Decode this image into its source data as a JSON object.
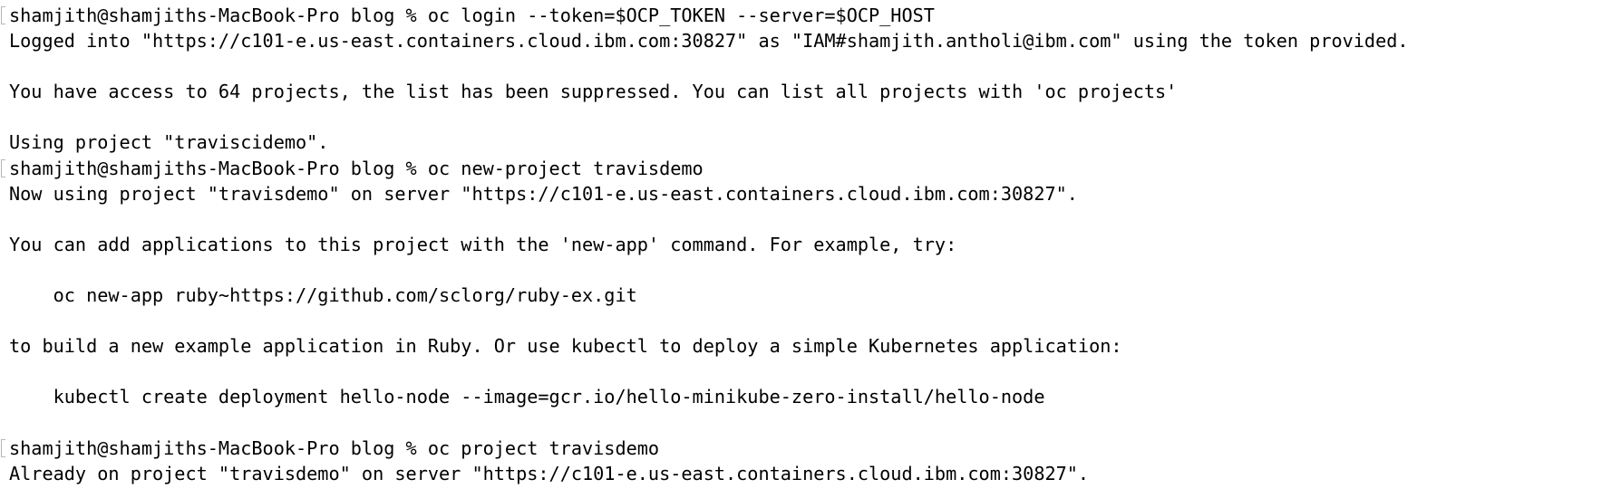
{
  "terminal": {
    "lines": [
      {
        "text": "shamjith@shamjiths-MacBook-Pro blog % oc login --token=$OCP_TOKEN --server=$OCP_HOST",
        "prompt": true
      },
      {
        "text": "Logged into \"https://c101-e.us-east.containers.cloud.ibm.com:30827\" as \"IAM#shamjith.antholi@ibm.com\" using the token provided.",
        "prompt": false
      },
      {
        "text": "",
        "prompt": false
      },
      {
        "text": "You have access to 64 projects, the list has been suppressed. You can list all projects with 'oc projects'",
        "prompt": false
      },
      {
        "text": "",
        "prompt": false
      },
      {
        "text": "Using project \"traviscidemo\".",
        "prompt": false
      },
      {
        "text": "shamjith@shamjiths-MacBook-Pro blog % oc new-project travisdemo",
        "prompt": true
      },
      {
        "text": "Now using project \"travisdemo\" on server \"https://c101-e.us-east.containers.cloud.ibm.com:30827\".",
        "prompt": false
      },
      {
        "text": "",
        "prompt": false
      },
      {
        "text": "You can add applications to this project with the 'new-app' command. For example, try:",
        "prompt": false
      },
      {
        "text": "",
        "prompt": false
      },
      {
        "text": "    oc new-app ruby~https://github.com/sclorg/ruby-ex.git",
        "prompt": false
      },
      {
        "text": "",
        "prompt": false
      },
      {
        "text": "to build a new example application in Ruby. Or use kubectl to deploy a simple Kubernetes application:",
        "prompt": false
      },
      {
        "text": "",
        "prompt": false
      },
      {
        "text": "    kubectl create deployment hello-node --image=gcr.io/hello-minikube-zero-install/hello-node",
        "prompt": false
      },
      {
        "text": "",
        "prompt": false
      },
      {
        "text": "shamjith@shamjiths-MacBook-Pro blog % oc project travisdemo",
        "prompt": true
      },
      {
        "text": "Already on project \"travisdemo\" on server \"https://c101-e.us-east.containers.cloud.ibm.com:30827\".",
        "prompt": false
      }
    ]
  }
}
